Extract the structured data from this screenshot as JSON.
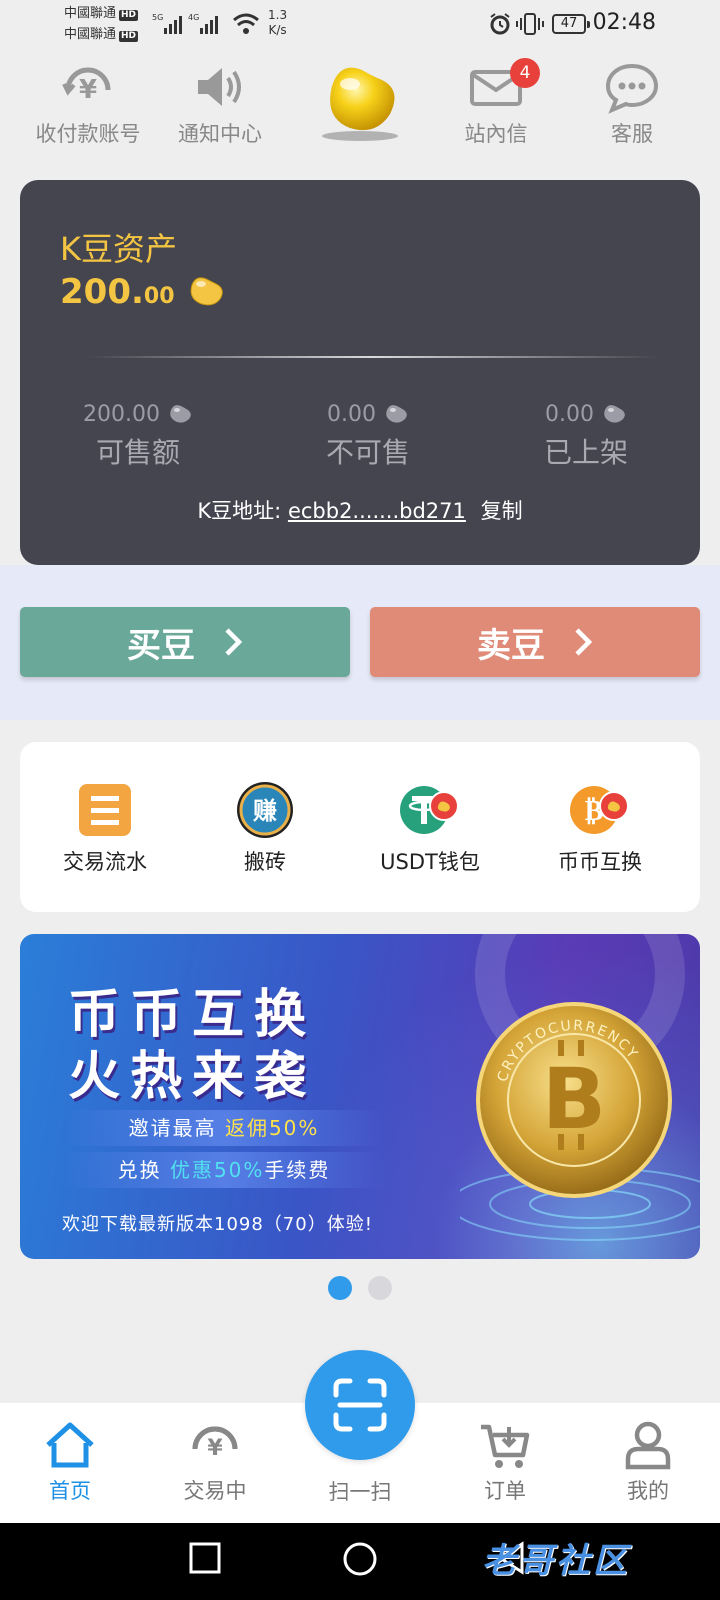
{
  "status_bar": {
    "carrier1": "中國聯通",
    "carrier2": "中國聯通",
    "hd": "HD",
    "net_speed_value": "1.3",
    "net_speed_unit": "K/s",
    "battery": "47",
    "time": "02:48"
  },
  "top_actions": [
    {
      "label": "收付款账号",
      "icon": "yen-refresh-icon"
    },
    {
      "label": "通知中心",
      "icon": "speaker-icon"
    },
    {
      "label": "",
      "icon": "gold-bean-logo"
    },
    {
      "label": "站內信",
      "icon": "mail-icon",
      "badge": "4"
    },
    {
      "label": "客服",
      "icon": "chat-icon"
    }
  ],
  "asset": {
    "title": "K豆资产",
    "amount_int": "200.",
    "amount_dec": "00",
    "stats": [
      {
        "value": "200.00",
        "label": "可售额"
      },
      {
        "value": "0.00",
        "label": "不可售"
      },
      {
        "value": "0.00",
        "label": "已上架"
      }
    ],
    "address_label": "K豆地址:",
    "address_value": "ecbb2.......bd271",
    "copy_label": "复制"
  },
  "actions": {
    "buy_label": "买豆",
    "sell_label": "卖豆",
    "chevron": "›"
  },
  "features": [
    {
      "label": "交易流水",
      "icon": "ledger-icon"
    },
    {
      "label": "搬砖",
      "icon": "earn-icon",
      "icon_text": "赚"
    },
    {
      "label": "USDT钱包",
      "icon": "usdt-wallet-icon"
    },
    {
      "label": "币币互换",
      "icon": "bitcoin-exchange-icon"
    }
  ],
  "banner": {
    "line1": "币币互换",
    "line2": "火热来袭",
    "pill1_prefix": "邀请最高",
    "pill1_highlight": "返佣50%",
    "pill2_prefix": "兑换",
    "pill2_highlight": "优惠50%",
    "pill2_suffix": "手续费",
    "footer": "欢迎下载最新版本1098（70）体验!",
    "coin_text": "CRYPTOCURRENCY"
  },
  "carousel": {
    "count": 2,
    "active": 0
  },
  "tabbar": {
    "home": "首页",
    "trading": "交易中",
    "scan": "扫一扫",
    "orders": "订单",
    "mine": "我的"
  },
  "watermark": "老哥社区",
  "colors": {
    "accent": "#2f9bea",
    "gold": "#f4c542",
    "buy": "#6aa89a",
    "sell": "#df8b78",
    "card_dark": "#45454f",
    "badge": "#e8413b"
  }
}
